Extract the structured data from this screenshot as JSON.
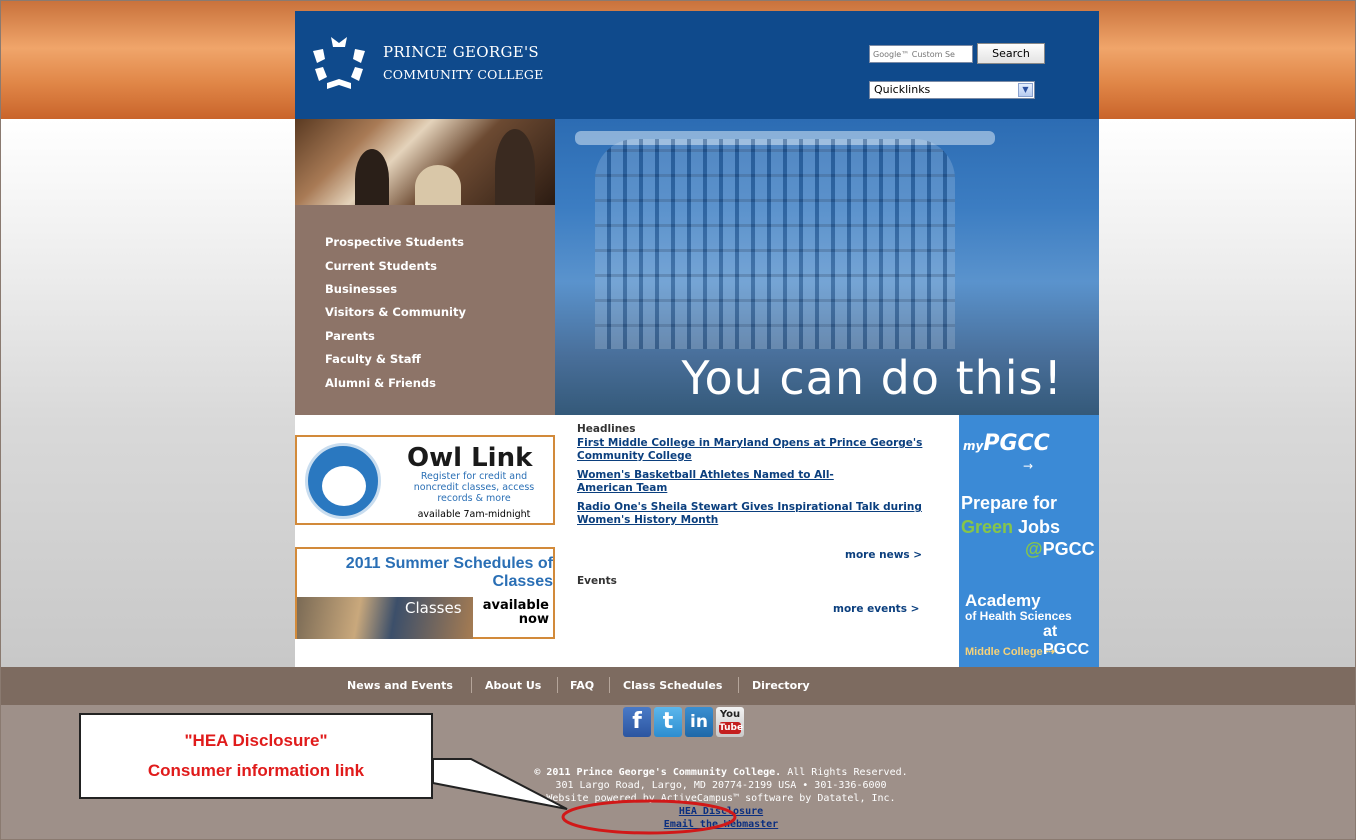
{
  "header": {
    "college_name_line1": "PRINCE GEORGE'S",
    "college_name_line2": "COMMUNITY COLLEGE",
    "search_placeholder": "Google™ Custom Se",
    "search_button": "Search",
    "quicklinks_selected": "Quicklinks"
  },
  "hero": {
    "tagline": "You can do this!",
    "nav": [
      "Prospective Students",
      "Current Students",
      "Businesses",
      "Visitors & Community",
      "Parents",
      "Faculty & Staff",
      "Alumni & Friends"
    ]
  },
  "owl_link": {
    "title": "Owl Link",
    "description": "Register for credit and noncredit classes, access records & more",
    "hours": "available 7am-midnight"
  },
  "summer_banner": {
    "title": "2011 Summer Schedules of Classes",
    "image_text": "Classes",
    "availability": "available now"
  },
  "news": {
    "headlines_label": "Headlines",
    "headlines": [
      "First Middle College in Maryland Opens at Prince George's Community College",
      "Women's Basketball Athletes Named to All-American Team",
      "Radio One's Sheila Stewart Gives Inspirational Talk during Women's History Month"
    ],
    "more_news": "more news >",
    "events_label": "Events",
    "more_events": "more events >"
  },
  "right_column": {
    "mypgcc": "PGCC",
    "mypgcc_prefix": "my",
    "prepare_line1": "Prepare for",
    "prepare_green": "Green",
    "prepare_jobs": "Jobs",
    "prepare_at": "@",
    "prepare_pgcc": "PGCC",
    "academy_line1": "Academy",
    "academy_line2": "of Health Sciences",
    "academy_line3": "at PGCC",
    "middle_college": "Middle College"
  },
  "footer": {
    "nav": [
      "News and Events",
      "About Us",
      "FAQ",
      "Class Schedules",
      "Directory"
    ],
    "copyright_bold": "© 2011 Prince George's Community College.",
    "copyright_rest": "All Rights Reserved.",
    "address": "301 Largo Road, Largo, MD 20774-2199 USA • 301-336-6000",
    "powered": "Website powered by ActiveCampus™ software by Datatel, Inc.",
    "hea_link": "HEA Disclosure",
    "webmaster_link": "Email the Webmaster",
    "social": [
      "facebook-icon",
      "twitter-icon",
      "linkedin-icon",
      "youtube-icon"
    ]
  },
  "annotation": {
    "line1": "\"HEA Disclosure\"",
    "line2": "Consumer information link",
    "color": "#e01b1b"
  }
}
